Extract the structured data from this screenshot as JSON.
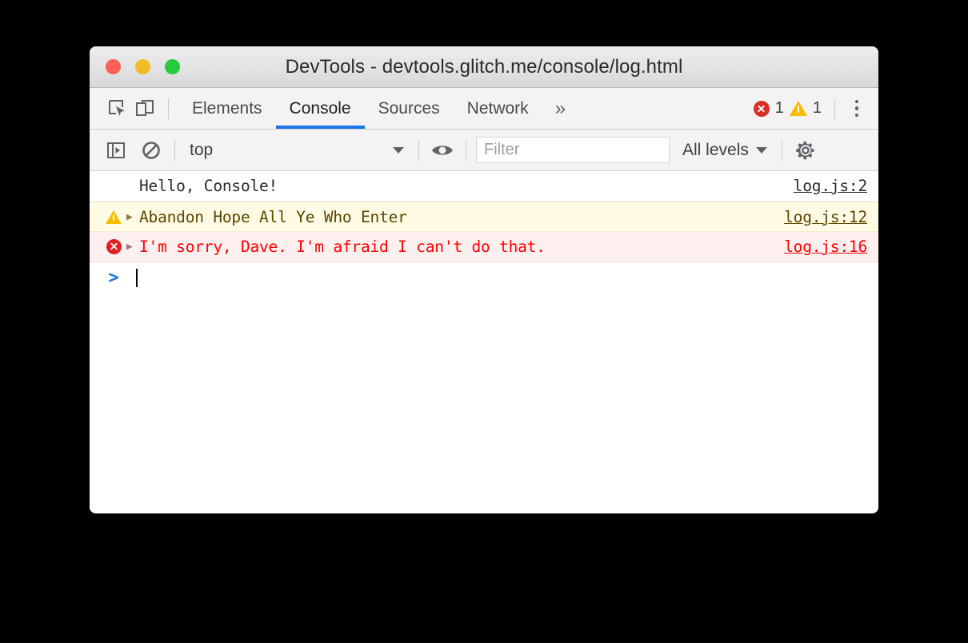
{
  "window": {
    "title": "DevTools - devtools.glitch.me/console/log.html",
    "traffic_lights": [
      {
        "name": "close",
        "color": "#ff5f56"
      },
      {
        "name": "minimize",
        "color": "#f3bc26"
      },
      {
        "name": "zoom",
        "color": "#27c93f"
      }
    ]
  },
  "tabbar": {
    "inspect_icon": "inspect-cursor-icon",
    "device_icon": "device-toolbar-icon",
    "tabs": [
      {
        "label": "Elements",
        "active": false
      },
      {
        "label": "Console",
        "active": true
      },
      {
        "label": "Sources",
        "active": false
      },
      {
        "label": "Network",
        "active": false
      }
    ],
    "overflow_label": "»",
    "error_count": "1",
    "warning_count": "1",
    "menu_icon": "kebab-menu-icon",
    "active_tab_underline_color": "#1a73e8"
  },
  "console_toolbar": {
    "sidebar_toggle_icon": "console-sidebar-toggle-icon",
    "clear_icon": "clear-console-icon",
    "context": {
      "value": "top",
      "options": [
        "top"
      ]
    },
    "eye_icon": "live-expression-eye-icon",
    "filter": {
      "value": "",
      "placeholder": "Filter"
    },
    "levels": {
      "value": "All levels",
      "options": [
        "All levels"
      ]
    },
    "settings_icon": "gear-icon"
  },
  "console": {
    "messages": [
      {
        "level": "log",
        "icon": "",
        "expandable": false,
        "text": "Hello, Console!",
        "source": "log.js:2"
      },
      {
        "level": "warning",
        "icon": "warning-triangle-icon",
        "expandable": true,
        "text": "Abandon Hope All Ye Who Enter",
        "source": "log.js:12"
      },
      {
        "level": "error",
        "icon": "error-circle-icon",
        "expandable": true,
        "text": "I'm sorry, Dave. I'm afraid I can't do that.",
        "source": "log.js:16"
      }
    ],
    "prompt": {
      "chevron": ">",
      "value": ""
    }
  },
  "colors": {
    "accent_blue": "#1a73e8",
    "error_red": "#ff0000",
    "error_icon_red": "#e02020",
    "warning_yellow": "#f5bc00",
    "warning_text": "#5c4500",
    "warning_row_bg": "#fffbe5",
    "error_row_bg": "#fff0f0",
    "toolbar_bg": "#f3f3f3",
    "log_text": "#2a2a33"
  }
}
